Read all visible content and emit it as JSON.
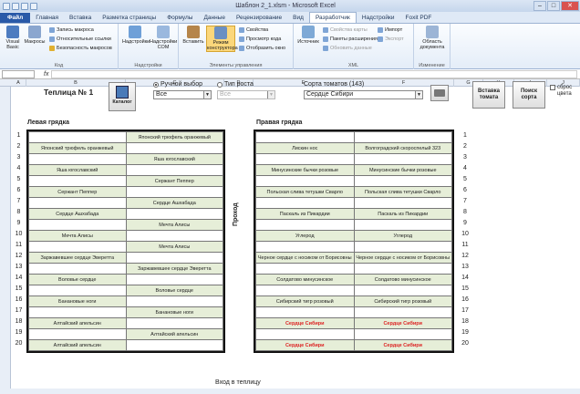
{
  "window": {
    "title": "Шаблон 2_1.xlsm - Microsoft Excel"
  },
  "tabs": [
    "Файл",
    "Главная",
    "Вставка",
    "Разметка страницы",
    "Формулы",
    "Данные",
    "Рецензирование",
    "Вид",
    "Разработчик",
    "Надстройки",
    "Foxit PDF"
  ],
  "ribbon": {
    "code": {
      "label": "Код",
      "visual_basic": "Visual Basic",
      "macros": "Макросы",
      "record": "Запись макроса",
      "relative": "Относительные ссылки",
      "security": "Безопасность макросов"
    },
    "addins": {
      "label": "Надстройки",
      "addins": "Надстройки",
      "com": "Надстройки COM"
    },
    "controls": {
      "label": "Элементы управления",
      "insert": "Вставить",
      "design": "Режим конструктора",
      "properties": "Свойства",
      "view_code": "Просмотр кода",
      "run_dialog": "Отобразить окно"
    },
    "xml": {
      "label": "XML",
      "source": "Источник",
      "map_props": "Свойства карты",
      "expansion": "Пакеты расширения",
      "refresh": "Обновить данные",
      "import": "Импорт",
      "export": "Экспорт"
    },
    "modify": {
      "label": "Изменение",
      "doc_panel": "Область документа"
    }
  },
  "formula_bar": {
    "fx": "fx"
  },
  "columns": [
    "A",
    "B",
    "C",
    "D",
    "E",
    "F",
    "G",
    "H",
    "I",
    "J"
  ],
  "sheet": {
    "title": "Теплица № 1",
    "catalog_button": "Каталог",
    "radio_manual": "Ручной выбор",
    "radio_type": "Тип роста",
    "combo_all_1": "Все",
    "combo_all_2": "Все",
    "sorta_label": "Сорта томатов (143)",
    "sorta_value": "Сердце Сибири",
    "insert_button": "Вставка томата",
    "search_button": "Поиск сорта",
    "clear_label": "сброс цвета",
    "left_bed_title": "Левая грядка",
    "right_bed_title": "Правая грядка",
    "aisle": "Проход",
    "entrance": "Вход в теплицу",
    "row_numbers": [
      "1",
      "2",
      "3",
      "4",
      "5",
      "6",
      "7",
      "8",
      "9",
      "10",
      "11",
      "12",
      "13",
      "14",
      "15",
      "16",
      "17",
      "18",
      "19",
      "20"
    ],
    "left_bed": [
      [
        "",
        "Японский трюфель оранжевый"
      ],
      [
        "Японский трюфель оранжевый",
        ""
      ],
      [
        "",
        "Яша югославский"
      ],
      [
        "Яша югославский",
        ""
      ],
      [
        "",
        "Сержант Пеппер"
      ],
      [
        "Сержант Пеппер",
        ""
      ],
      [
        "",
        "Сердце Ашхабада"
      ],
      [
        "Сердце Ашхабада",
        ""
      ],
      [
        "",
        "Мечта Алисы"
      ],
      [
        "Мечта Алисы",
        ""
      ],
      [
        "",
        "Мечта Алисы"
      ],
      [
        "Заржавевшее сердце Эверетта",
        ""
      ],
      [
        "",
        "Заржавевшее сердце Эверетта"
      ],
      [
        "Воловье сердце",
        ""
      ],
      [
        "",
        "Воловье сердце"
      ],
      [
        "Банановые ноги",
        ""
      ],
      [
        "",
        "Банановые ноги"
      ],
      [
        "Алтайский апельсин",
        ""
      ],
      [
        "",
        "Алтайский апельсин"
      ],
      [
        "Алтайский апельсин",
        ""
      ]
    ],
    "right_bed": [
      [
        "",
        ""
      ],
      [
        "Лискин нос",
        "Волгоградский скороспелый 323"
      ],
      [
        "",
        ""
      ],
      [
        "Минусинские бычки розовые",
        "Минусинские бычки розовые"
      ],
      [
        "",
        ""
      ],
      [
        "Польская слива тетушки Сварло",
        "Польская слива тетушки Сварло"
      ],
      [
        "",
        ""
      ],
      [
        "Паскаль из Пикардии",
        "Паскаль из Пикардии"
      ],
      [
        "",
        ""
      ],
      [
        "Углерод",
        "Углерод"
      ],
      [
        "",
        ""
      ],
      [
        "Черное сердце с носиком от Борисовны",
        "Черное сердце с носиком от Борисовны"
      ],
      [
        "",
        ""
      ],
      [
        "Солдатово минусинское",
        "Солдатово минусинское"
      ],
      [
        "",
        ""
      ],
      [
        "Сибирский тигр розовый",
        "Сибирский тигр розовый"
      ],
      [
        "",
        ""
      ],
      [
        "Сердце Сибири",
        "Сердце Сибири"
      ],
      [
        "",
        ""
      ],
      [
        "Сердце Сибири",
        "Сердце Сибири"
      ]
    ]
  }
}
